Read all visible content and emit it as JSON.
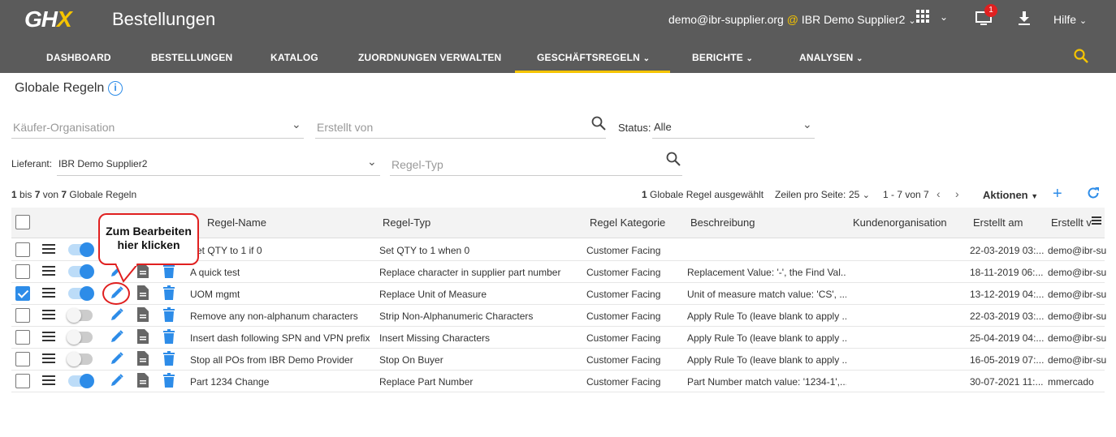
{
  "header": {
    "logo_main": "GH",
    "logo_x": "X",
    "title": "Bestellungen",
    "user_email": "demo@ibr-supplier.org",
    "user_at": "@",
    "user_org": "IBR Demo Supplier2",
    "notification_count": "1",
    "help_label": "Hilfe"
  },
  "nav": {
    "items": [
      "DASHBOARD",
      "BESTELLUNGEN",
      "KATALOG",
      "ZUORDNUNGEN VERWALTEN",
      "GESCHÄFTSREGELN",
      "BERICHTE",
      "ANALYSEN"
    ],
    "active": "GESCHÄFTSREGELN",
    "accent": "#f5c400"
  },
  "page": {
    "title": "Globale Regeln"
  },
  "filters": {
    "buyer_org_placeholder": "Käufer-Organisation",
    "created_by_placeholder": "Erstellt von",
    "status_label": "Status:",
    "status_value": "Alle",
    "supplier_label": "Lieferant:",
    "supplier_value": "IBR Demo Supplier2",
    "rule_type_placeholder": "Regel-Typ"
  },
  "summary": {
    "range_start": "1",
    "range_mid": " bis ",
    "range_end": "7",
    "range_of": " von ",
    "range_total": "7",
    "range_suffix": " Globale Regeln",
    "selected_count": "1",
    "selected_text": " Globale Regel ausgewählt",
    "rows_per_page_label": "Zeilen pro Seite:",
    "rows_per_page": "25",
    "page_range": "1 - 7 von 7",
    "actions_label": "Aktionen"
  },
  "table": {
    "columns": [
      "Regel-Name",
      "Regel-Typ",
      "Regel Kategorie",
      "Beschreibung",
      "Kundenorganisation",
      "Erstellt am",
      "Erstellt v"
    ],
    "rows": [
      {
        "checked": false,
        "active": true,
        "name": "Set QTY to 1 if 0",
        "type": "Set QTY to 1 when 0",
        "category": "Customer Facing",
        "description": "",
        "customer_org": "",
        "created_at": "22-03-2019 03:...",
        "created_by": "demo@ibr-sup"
      },
      {
        "checked": false,
        "active": true,
        "name": "A quick test",
        "type": "Replace character in supplier part number",
        "category": "Customer Facing",
        "description": "Replacement Value: '-', the Find Val...",
        "customer_org": "",
        "created_at": "18-11-2019 06:...",
        "created_by": "demo@ibr-sup"
      },
      {
        "checked": true,
        "active": true,
        "name": "UOM mgmt",
        "type": "Replace Unit of Measure",
        "category": "Customer Facing",
        "description": "Unit of measure match value: 'CS', ...",
        "customer_org": "",
        "created_at": "13-12-2019 04:...",
        "created_by": "demo@ibr-sup"
      },
      {
        "checked": false,
        "active": false,
        "name": "Remove any non-alphanum characters",
        "type": "Strip Non-Alphanumeric Characters",
        "category": "Customer Facing",
        "description": "Apply Rule To (leave blank to apply ...",
        "customer_org": "",
        "created_at": "22-03-2019 03:...",
        "created_by": "demo@ibr-sup"
      },
      {
        "checked": false,
        "active": false,
        "name": "Insert dash following SPN and VPN prefix",
        "type": "Insert Missing Characters",
        "category": "Customer Facing",
        "description": "Apply Rule To (leave blank to apply ...",
        "customer_org": "",
        "created_at": "25-04-2019 04:...",
        "created_by": "demo@ibr-sup"
      },
      {
        "checked": false,
        "active": false,
        "name": "Stop all POs from IBR Demo Provider",
        "type": "Stop On Buyer",
        "category": "Customer Facing",
        "description": "Apply Rule To (leave blank to apply ...",
        "customer_org": "",
        "created_at": "16-05-2019 07:...",
        "created_by": "demo@ibr-sup"
      },
      {
        "checked": false,
        "active": true,
        "name": "Part 1234 Change",
        "type": "Replace Part Number",
        "category": "Customer Facing",
        "description": "Part Number match value: '1234-1',...",
        "customer_org": "",
        "created_at": "30-07-2021 11:...",
        "created_by": "mmercado"
      }
    ]
  },
  "callout": {
    "line1": "Zum Bearbeiten",
    "line2": "hier klicken"
  },
  "icons": [
    "grid-icon",
    "notification-icon",
    "download-icon",
    "search-icon",
    "info-icon",
    "menu-icon",
    "edit-icon",
    "document-icon",
    "delete-icon",
    "refresh-icon",
    "add-icon"
  ],
  "colors": {
    "primary": "#2d8ce8",
    "header": "#5b5b5b",
    "accent": "#f5c400",
    "callout": "#e02020"
  }
}
